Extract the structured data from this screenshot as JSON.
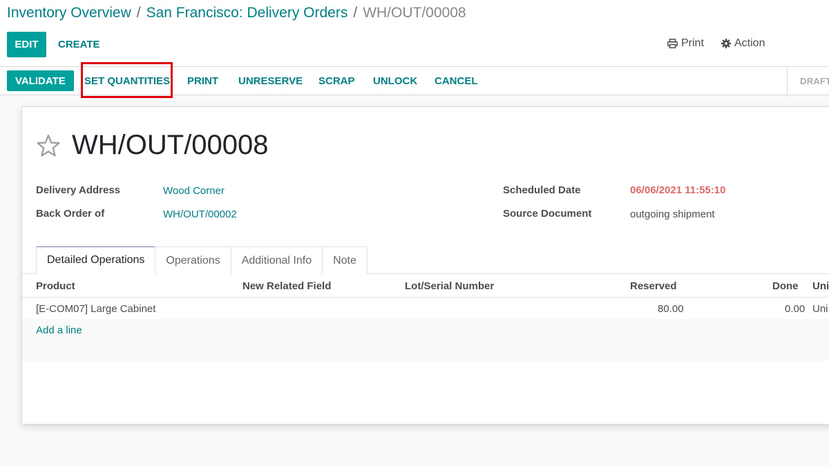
{
  "breadcrumb": {
    "items": [
      "Inventory Overview",
      "San Francisco: Delivery Orders"
    ],
    "separator": "/",
    "current": "WH/OUT/00008"
  },
  "control_panel": {
    "edit_label": "EDIT",
    "create_label": "CREATE",
    "print_label": "Print",
    "action_label": "Action"
  },
  "statusbar": {
    "buttons": [
      "VALIDATE",
      "SET QUANTITIES",
      "PRINT",
      "UNRESERVE",
      "SCRAP",
      "UNLOCK",
      "CANCEL"
    ],
    "state": "DRAFT"
  },
  "record": {
    "name": "WH/OUT/00008",
    "fields": {
      "delivery_address_label": "Delivery Address",
      "delivery_address": "Wood Corner",
      "back_order_label": "Back Order of",
      "back_order": "WH/OUT/00002",
      "scheduled_date_label": "Scheduled Date",
      "scheduled_date": "06/06/2021 11:55:10",
      "source_document_label": "Source Document",
      "source_document": "outgoing shipment"
    }
  },
  "tabs": [
    "Detailed Operations",
    "Operations",
    "Additional Info",
    "Note"
  ],
  "table": {
    "columns": [
      "Product",
      "New Related Field",
      "Lot/Serial Number",
      "Reserved",
      "Done",
      "Uni"
    ],
    "rows": [
      {
        "product": "[E-COM07] Large Cabinet",
        "reserved": "80.00",
        "done": "0.00",
        "unit": "Uni"
      }
    ],
    "add_line_label": "Add a line"
  },
  "colors": {
    "primary": "#00a09d",
    "link": "#017e84",
    "danger": "#dc6965",
    "highlight": "#e0000a"
  }
}
